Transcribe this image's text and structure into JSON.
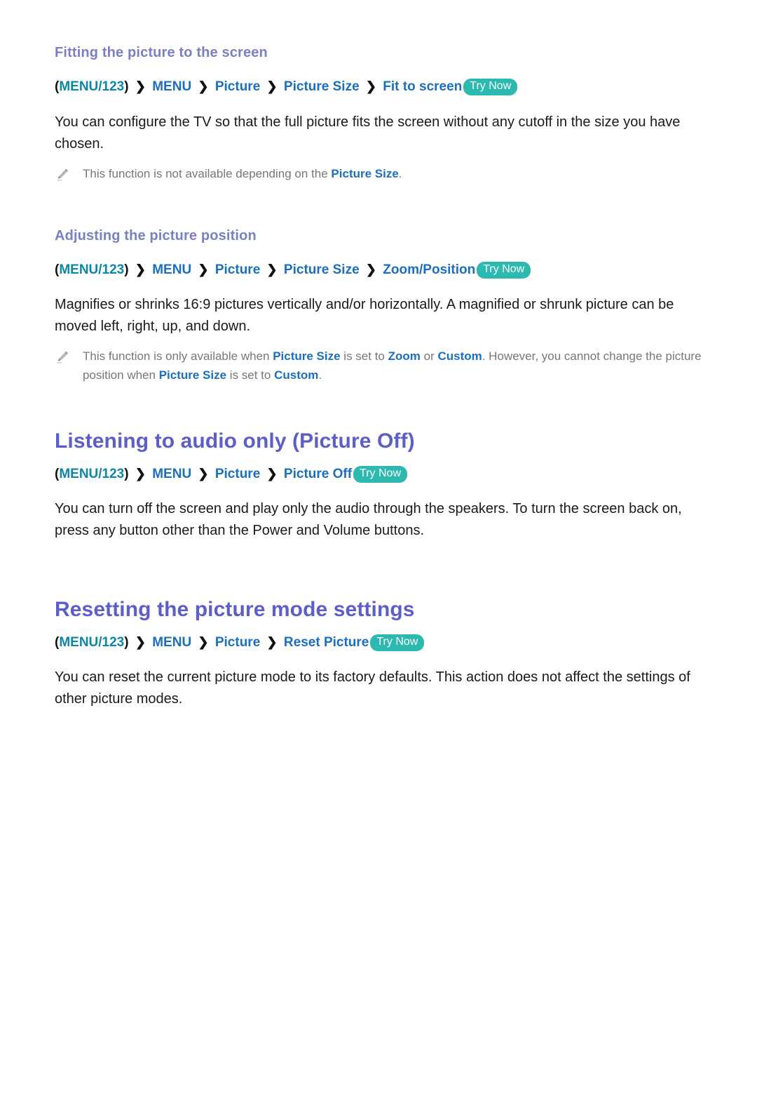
{
  "document": {
    "title": "Picture settings help page",
    "colors": {
      "h1": "#5b5fc7",
      "h2": "#7b7fc4",
      "crumb": "#1a6fbf",
      "menu123": "#0b87a8",
      "trynow_bg": "#2cb9b0",
      "body": "#1a1a1a",
      "note": "#777777"
    }
  },
  "sections": [
    {
      "id": "fitting-the-picture-to-the-screen",
      "level": "h2",
      "heading": "Fitting the picture to the screen",
      "path": {
        "open_paren": "(",
        "menu123": "MENU/123",
        "close_paren": ")",
        "separator": "❯",
        "crumbs": [
          "MENU",
          "Picture",
          "Picture Size",
          "Fit to screen"
        ],
        "try_now": "Try Now"
      },
      "body": "You can configure the TV so that the full picture fits the screen without any cutoff in the size you have chosen.",
      "note": {
        "icon": "pencil-icon",
        "before": "This function is not available depending on the ",
        "term1": "Picture Size",
        "after": "."
      }
    },
    {
      "id": "adjusting-the-picture-position",
      "level": "h2",
      "heading": "Adjusting the picture position",
      "path": {
        "open_paren": "(",
        "menu123": "MENU/123",
        "close_paren": ")",
        "separator": "❯",
        "crumbs": [
          "MENU",
          "Picture",
          "Picture Size",
          "Zoom/Position"
        ],
        "try_now": "Try Now"
      },
      "body": "Magnifies or shrinks 16:9 pictures vertically and/or horizontally. A magnified or shrunk picture can be moved left, right, up, and down.",
      "note": {
        "icon": "pencil-icon",
        "part1": "This function is only available when ",
        "term1": "Picture Size",
        "part2": " is set to ",
        "term2": "Zoom",
        "part3": " or ",
        "term3": "Custom",
        "part4": ". However, you cannot change the picture position when ",
        "term4": "Picture Size",
        "part5": " is set to ",
        "term5": "Custom",
        "part6": "."
      }
    },
    {
      "id": "listening-to-audio-only",
      "level": "h1",
      "heading": "Listening to audio only (Picture Off)",
      "path": {
        "open_paren": "(",
        "menu123": "MENU/123",
        "close_paren": ")",
        "separator": "❯",
        "crumbs": [
          "MENU",
          "Picture",
          "Picture Off"
        ],
        "try_now": "Try Now"
      },
      "body": "You can turn off the screen and play only the audio through the speakers. To turn the screen back on, press any button other than the Power and Volume buttons."
    },
    {
      "id": "resetting-the-picture-mode-settings",
      "level": "h1",
      "heading": "Resetting the picture mode settings",
      "path": {
        "open_paren": "(",
        "menu123": "MENU/123",
        "close_paren": ")",
        "separator": "❯",
        "crumbs": [
          "MENU",
          "Picture",
          "Reset Picture"
        ],
        "try_now": "Try Now"
      },
      "body": "You can reset the current picture mode to its factory defaults. This action does not affect the settings of other picture modes."
    }
  ]
}
